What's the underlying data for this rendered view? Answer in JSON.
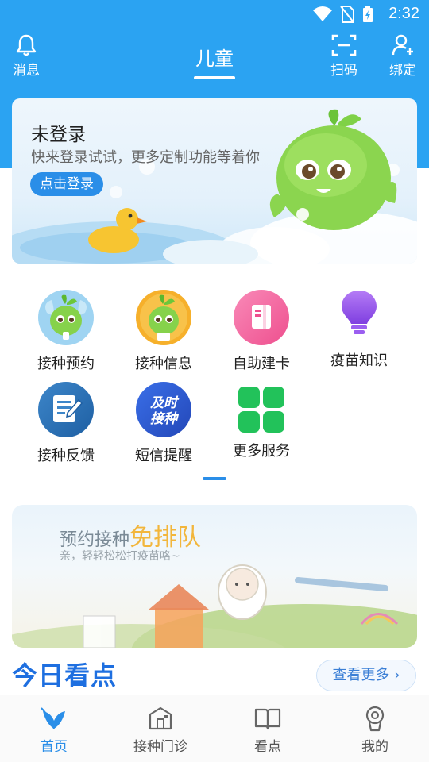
{
  "status_bar": {
    "time": "2:32"
  },
  "topnav": {
    "title": "儿童",
    "messages_label": "消息",
    "scan_label": "扫码",
    "bind_label": "绑定"
  },
  "login_banner": {
    "title": "未登录",
    "subtitle": "快来登录试试，更多定制功能等着你",
    "button_label": "点击登录"
  },
  "services": [
    {
      "label": "接种预约",
      "icon": "sprout-mascot-icon"
    },
    {
      "label": "接种信息",
      "icon": "sprout-mascot-orange-icon"
    },
    {
      "label": "自助建卡",
      "icon": "card-icon"
    },
    {
      "label": "疫苗知识",
      "icon": "lightbulb-icon"
    },
    {
      "label": "接种反馈",
      "icon": "feedback-icon"
    },
    {
      "label": "短信提醒",
      "icon": "sms-reminder-icon",
      "badge_text": [
        "及时",
        "接种"
      ]
    },
    {
      "label": "更多服务",
      "icon": "grid-icon"
    }
  ],
  "promo": {
    "title_prefix": "预约接种",
    "title_highlight": "免排队",
    "subtitle": "亲，轻轻松松打疫苗咯~"
  },
  "today": {
    "title": "今日看点",
    "more_label": "查看更多 ›"
  },
  "bottom_nav": [
    {
      "label": "首页",
      "icon": "home-sprout-icon",
      "active": true
    },
    {
      "label": "接种门诊",
      "icon": "clinic-icon",
      "active": false
    },
    {
      "label": "看点",
      "icon": "book-icon",
      "active": false
    },
    {
      "label": "我的",
      "icon": "profile-icon",
      "active": false
    }
  ],
  "colors": {
    "header_blue": "#2ba3f2",
    "accent_blue": "#2a8ee8",
    "title_blue": "#1e6fe0",
    "highlight_orange": "#f2b63c"
  }
}
